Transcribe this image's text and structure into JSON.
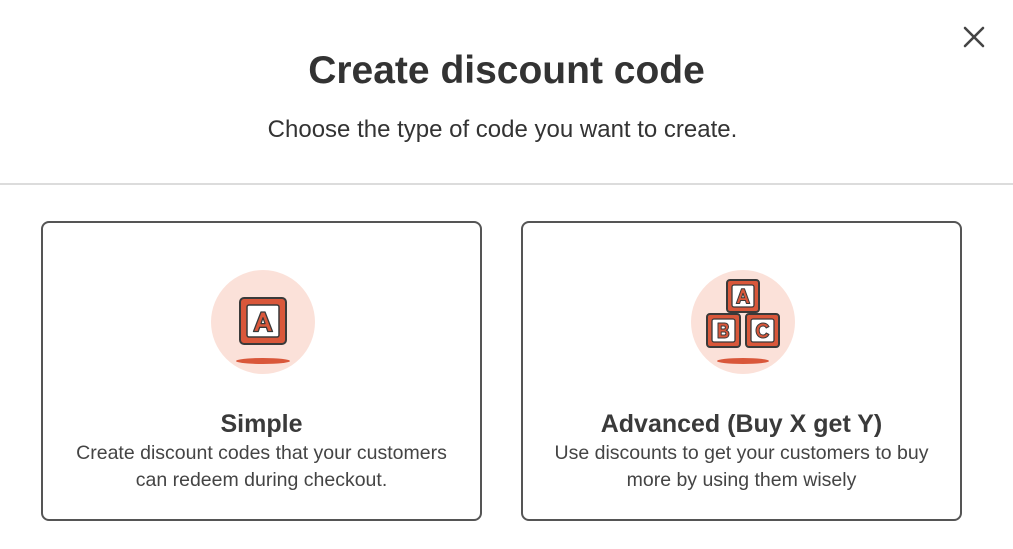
{
  "dialog": {
    "title": "Create discount code",
    "subtitle": "Choose the type of code you want to create.",
    "close_icon": "close-icon"
  },
  "options": [
    {
      "title": "Simple",
      "description": "Create discount codes that your customers can redeem during checkout.",
      "icon": "block-a-icon",
      "block_letters": [
        "A"
      ]
    },
    {
      "title": "Advanced (Buy X get Y)",
      "description": "Use discounts to get your customers to buy more by using them wisely",
      "icon": "abc-blocks-icon",
      "block_letters": [
        "A",
        "B",
        "C"
      ]
    }
  ],
  "colors": {
    "accent": "#d9573a",
    "icon_background": "#fbe1d9",
    "card_border": "#555555",
    "text": "#333333"
  }
}
